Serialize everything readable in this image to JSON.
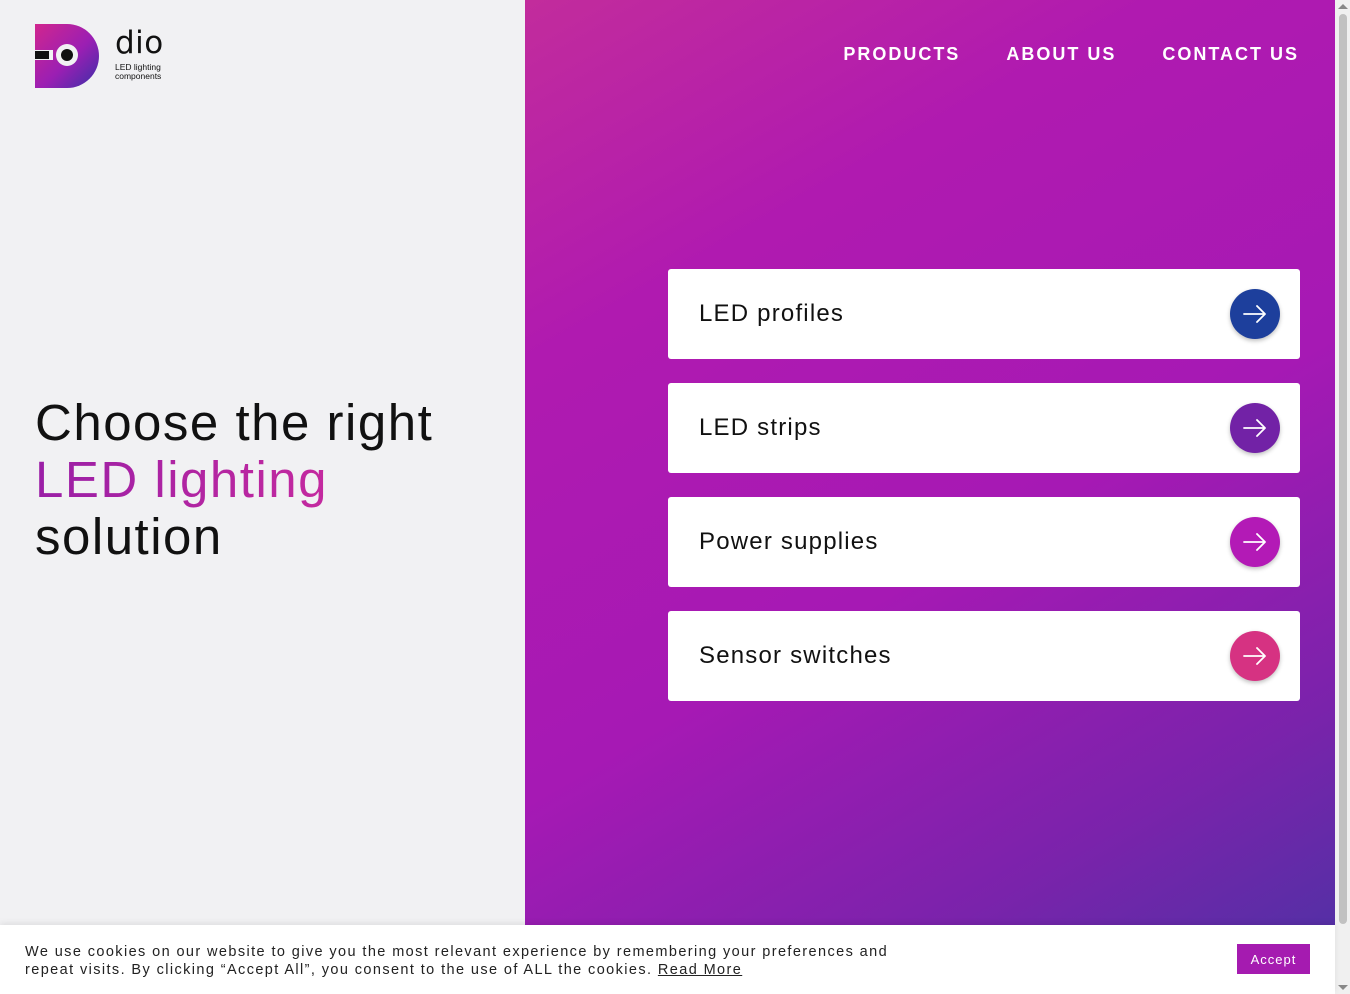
{
  "brand": {
    "name": "dio",
    "tagline": "LED lighting components"
  },
  "nav": {
    "items": [
      {
        "label": "PRODUCTS"
      },
      {
        "label": "ABOUT US"
      },
      {
        "label": "CONTACT US"
      }
    ]
  },
  "hero": {
    "line1": "Choose the right",
    "line2": "LED lighting",
    "line3": "solution",
    "accent_color": "#b01ab0"
  },
  "categories": [
    {
      "label": "LED profiles",
      "color": "#1d3f9c",
      "icon": "arrow-right-icon"
    },
    {
      "label": "LED strips",
      "color": "#7222a6",
      "icon": "arrow-right-icon"
    },
    {
      "label": "Power supplies",
      "color": "#b31ab6",
      "icon": "arrow-right-icon"
    },
    {
      "label": "Sensor switches",
      "color": "#d63282",
      "icon": "arrow-right-icon"
    }
  ],
  "cookie": {
    "text": "We use cookies on our website to give you the most relevant experience by remembering your preferences and repeat visits. By clicking “Accept All”, you consent to the use of ALL the cookies.",
    "read_more": "Read More",
    "accept_label": "Accept",
    "accept_color": "#a51bb0"
  }
}
